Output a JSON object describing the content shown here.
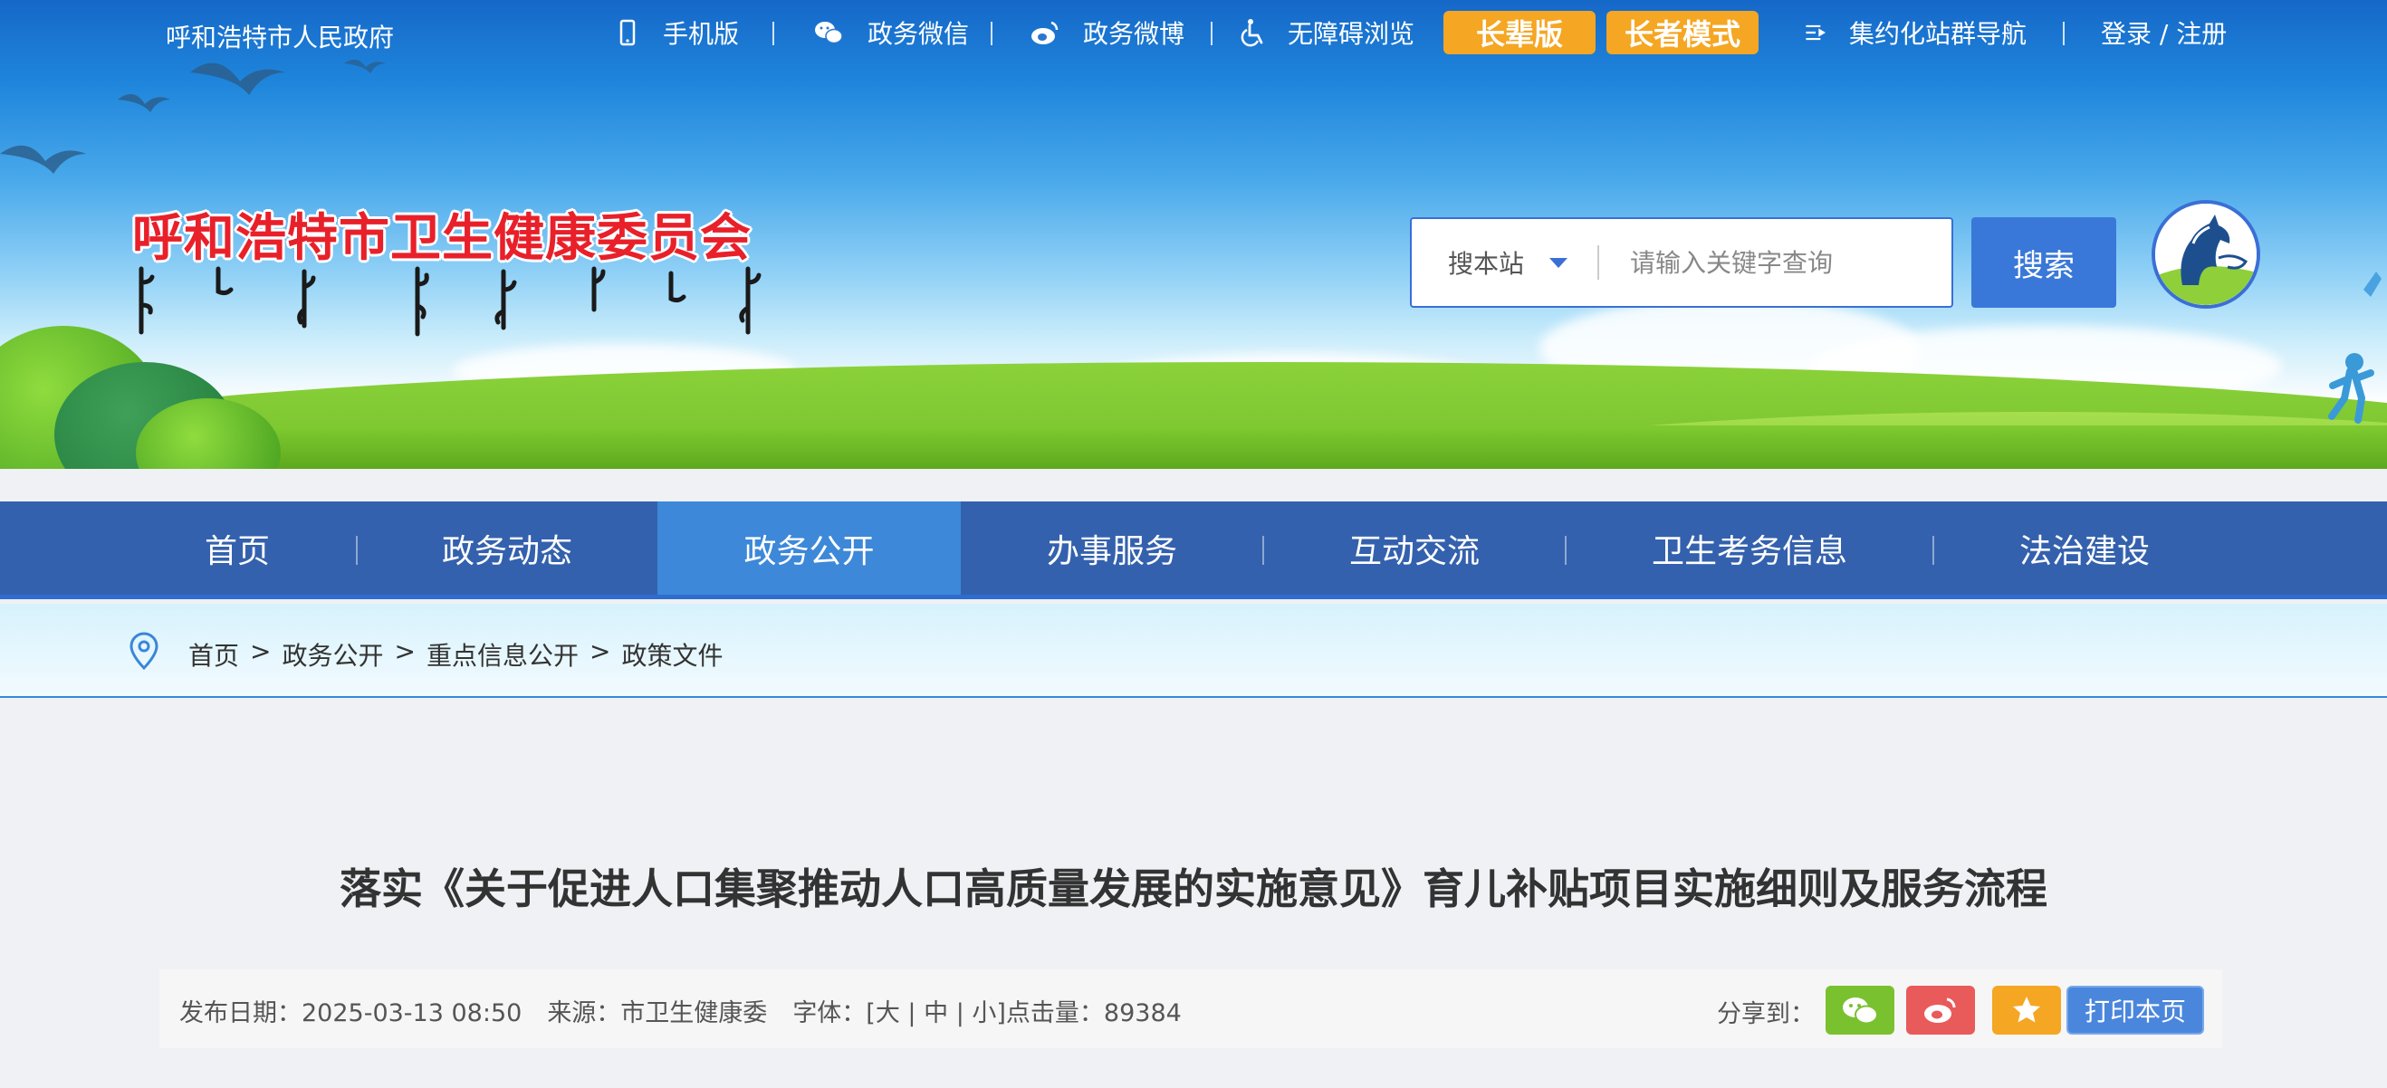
{
  "topbar": {
    "gov_name": "呼和浩特市人民政府",
    "mobile": "手机版",
    "wechat": "政务微信",
    "weibo": "政务微博",
    "accessibility": "无障碍浏览",
    "elder_version": "长辈版",
    "elder_mode": "长者模式",
    "site_nav": "集约化站群导航",
    "login": "登录 / 注册"
  },
  "header": {
    "site_title": "呼和浩特市卫生健康委员会"
  },
  "search": {
    "scope": "搜本站",
    "placeholder": "请输入关键字查询",
    "button": "搜索"
  },
  "nav": {
    "items": [
      {
        "label": "首页"
      },
      {
        "label": "政务动态"
      },
      {
        "label": "政务公开"
      },
      {
        "label": "办事服务"
      },
      {
        "label": "互动交流"
      },
      {
        "label": "卫生考务信息"
      },
      {
        "label": "法治建设"
      }
    ],
    "active_index": 2
  },
  "breadcrumb": {
    "items": [
      "首页",
      ">",
      "政务公开",
      ">",
      "重点信息公开",
      ">",
      "政策文件"
    ]
  },
  "article": {
    "title": "落实《关于促进人口集聚推动人口高质量发展的实施意见》育儿补贴项目实施细则及服务流程",
    "publish": "发布日期：2025-03-13 08:50",
    "source": "来源：市卫生健康委",
    "font": "字体：[大 | 中 | 小]点击量：89384",
    "share_label": "分享到：",
    "print": "打印本页"
  },
  "colors": {
    "nav_bg": "#3461ad",
    "nav_active": "#3d88d8",
    "elder_orange": "#f5a623",
    "title_red": "#e8202a",
    "wechat_green": "#7ac12f",
    "weibo_red": "#e95a5a",
    "favorite_orange": "#f5a623",
    "print_blue": "#4a86dc"
  }
}
